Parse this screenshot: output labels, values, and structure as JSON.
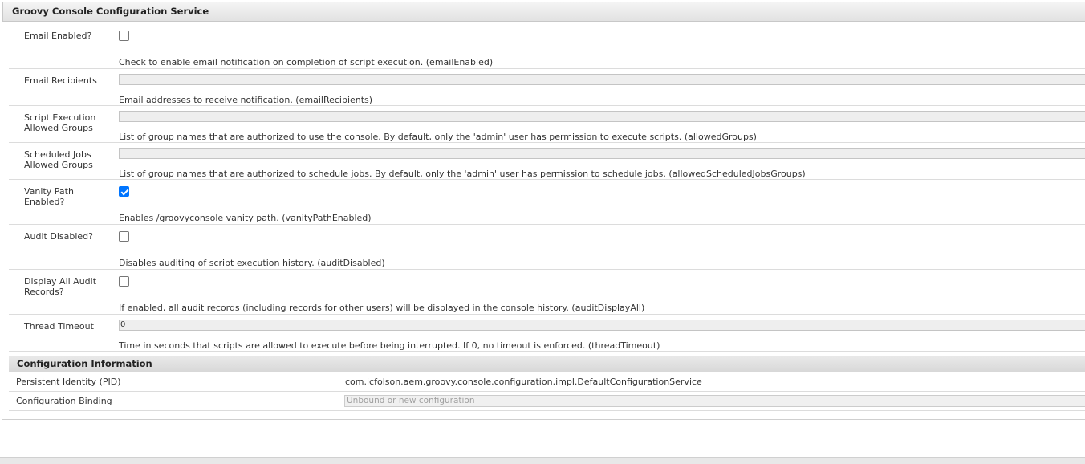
{
  "dialog": {
    "title": "Groovy Console Configuration Service"
  },
  "properties": [
    {
      "label": "Email Enabled?",
      "type": "checkbox",
      "checked": false,
      "description": "Check to enable email notification on completion of script execution. (emailEnabled)"
    },
    {
      "label": "Email Recipients",
      "type": "text",
      "value": "",
      "description": "Email addresses to receive notification. (emailRecipients)"
    },
    {
      "label": "Script Execution Allowed Groups",
      "type": "text",
      "value": "",
      "description": "List of group names that are authorized to use the console. By default, only the 'admin' user has permission to execute scripts. (allowedGroups)"
    },
    {
      "label": "Scheduled Jobs Allowed Groups",
      "type": "text",
      "value": "",
      "description": "List of group names that are authorized to schedule jobs. By default, only the 'admin' user has permission to schedule jobs. (allowedScheduledJobsGroups)"
    },
    {
      "label": "Vanity Path Enabled?",
      "type": "checkbox",
      "checked": true,
      "description": "Enables /groovyconsole vanity path. (vanityPathEnabled)"
    },
    {
      "label": "Audit Disabled?",
      "type": "checkbox",
      "checked": false,
      "description": "Disables auditing of script execution history. (auditDisabled)"
    },
    {
      "label": "Display All Audit Records?",
      "type": "checkbox",
      "checked": false,
      "description": "If enabled, all audit records (including records for other users) will be displayed in the console history. (auditDisplayAll)"
    },
    {
      "label": "Thread Timeout",
      "type": "text",
      "value": "0",
      "description": "Time in seconds that scripts are allowed to execute before being interrupted. If 0, no timeout is enforced. (threadTimeout)"
    }
  ],
  "config_info": {
    "heading": "Configuration Information",
    "pid_label": "Persistent Identity (PID)",
    "pid_value": "com.icfolson.aem.groovy.console.configuration.impl.DefaultConfigurationService",
    "binding_label": "Configuration Binding",
    "binding_value": "Unbound or new configuration"
  }
}
